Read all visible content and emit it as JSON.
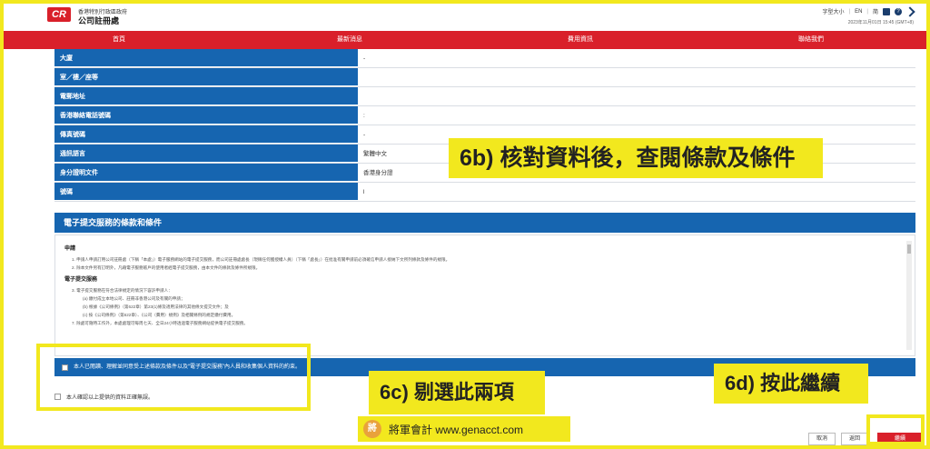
{
  "header": {
    "logo": "CR",
    "org_sub": "香港特別行政區政府",
    "org_name": "公司註冊處",
    "font_size_label": "字型大小",
    "lang_en": "EN",
    "lang_sc": "简",
    "timestamp": "2023年11月01日 15:45 (GMT+8)"
  },
  "nav": [
    "首頁",
    "最新消息",
    "費用資訊",
    "聯絡我們"
  ],
  "form": {
    "rows": [
      {
        "label": "大廈",
        "value": "-"
      },
      {
        "label": "室／樓／座等",
        "value": ""
      },
      {
        "label": "電郵地址",
        "value": ""
      },
      {
        "label": "香港聯絡電話號碼",
        "value": ":"
      },
      {
        "label": "傳真號碼",
        "value": "-"
      },
      {
        "label": "通訊語言",
        "value": "繁體中文"
      },
      {
        "label": "身分證明文件",
        "value": "香港身分證"
      },
      {
        "label": "號碼",
        "value": "l"
      }
    ]
  },
  "terms": {
    "title": "電子提交服務的條款和條件",
    "sections": [
      {
        "heading": "申請",
        "lines": [
          "1. 申請人申請訂用公司註冊處（下稱「本處」）電子服務網站的電子提交服務，而公司註冊處處長（現稱任何獲授權人員）（下稱「處長」）在批准有關申請前必須確信申請人接納下文所列條款及條件的規限。",
          "2. 除本文件另有訂明外，凡藉電子服務帳戶的使用者經電子提交服務，由本文件的條款及條件所規限。"
        ]
      },
      {
        "heading": "電子提交服務",
        "lines": [
          "3. 電子提交服務在符合法律規定的情況下容許申請人：",
          "(a) 繳付成立本地公司、註冊非香港公司及有關的申請；",
          "(b) 根據《公司條例》（第622章）第23(1)條及適用法律的其他條文提交文件；及",
          "(c) 按《公司條例》（第622章）、《公司（費用）規例》及相關條例的規定繳付費用。",
          "7. 除處可隨時工作外，本處處理可每周七天、全日24小時透過電子服務網站提供電子提交服務。"
        ]
      }
    ]
  },
  "agree": {
    "label": "本人已閱讀、理解並同意受上述條款及條件以及“電子提交服務”內人員和收集個人資料的約束。",
    "confirm_label": "本人確認以上提供的資料正確無誤。"
  },
  "callouts": {
    "c6b": "6b) 核對資料後，查閱條款及條件",
    "c6c": "6c) 剔選此兩項",
    "c6d": "6d) 按此繼續"
  },
  "watermark": {
    "seal": "將",
    "text": "將軍會計 www.genacct.com"
  },
  "buttons": {
    "cancel": "取消",
    "back": "返回",
    "continue": "繼續"
  }
}
